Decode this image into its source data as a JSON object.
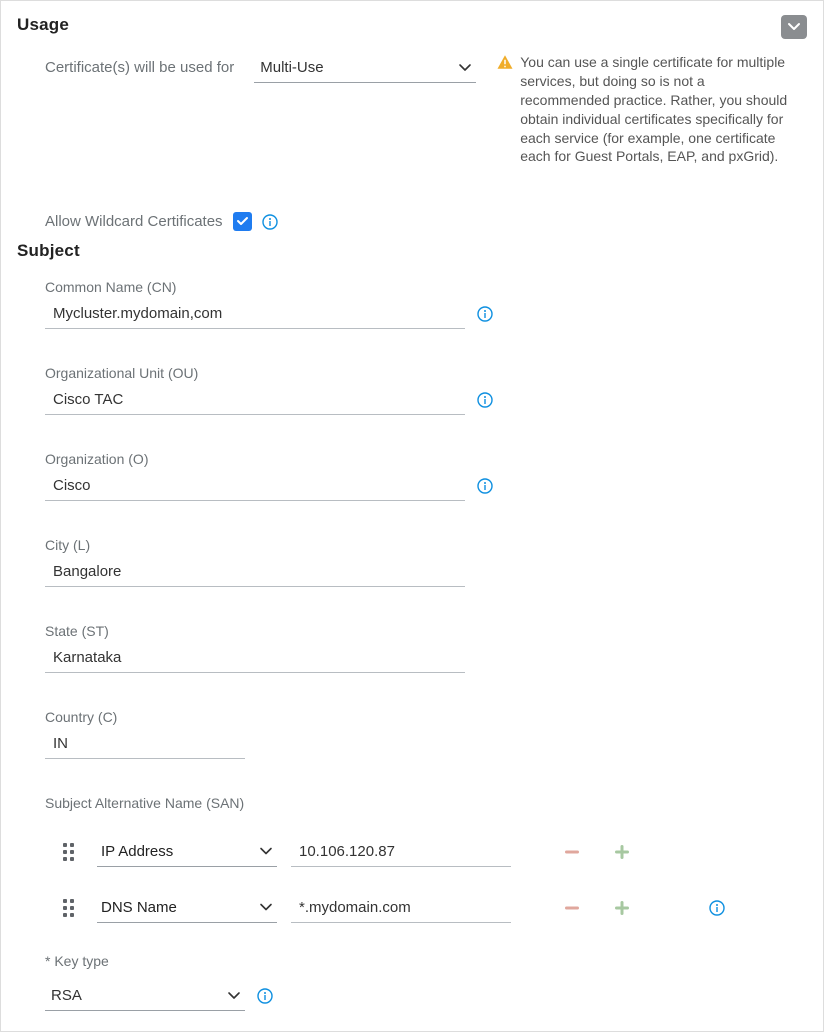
{
  "usage": {
    "heading": "Usage",
    "cert_label": "Certificate(s) will be used for",
    "cert_value": "Multi-Use",
    "warning": "You can use a single certificate for multiple services, but doing so is not a recommended practice. Rather, you should obtain individual certificates specifically for each service (for example, one certificate each for Guest Portals, EAP, and pxGrid).",
    "wildcard_label": "Allow Wildcard Certificates",
    "wildcard_checked": true
  },
  "subject": {
    "heading": "Subject",
    "cn": {
      "label": "Common Name (CN)",
      "value": "Mycluster.mydomain,com"
    },
    "ou": {
      "label": "Organizational Unit (OU)",
      "value": "Cisco TAC"
    },
    "o": {
      "label": "Organization (O)",
      "value": "Cisco"
    },
    "l": {
      "label": "City (L)",
      "value": "Bangalore"
    },
    "st": {
      "label": "State (ST)",
      "value": "Karnataka"
    },
    "c": {
      "label": "Country (C)",
      "value": "IN"
    },
    "san_label": "Subject Alternative Name (SAN)",
    "san": [
      {
        "type": "IP Address",
        "value": "10.106.120.87"
      },
      {
        "type": "DNS Name",
        "value": "*.mydomain.com"
      }
    ]
  },
  "keytype": {
    "label": "* Key type",
    "value": "RSA"
  },
  "colors": {
    "accent_blue": "#1f7cf0",
    "info_stroke": "#0d8fe0",
    "warn_fill": "#f0ad2a",
    "plus_fill": "#a7c8a1",
    "minus_fill": "#e0a79d"
  }
}
